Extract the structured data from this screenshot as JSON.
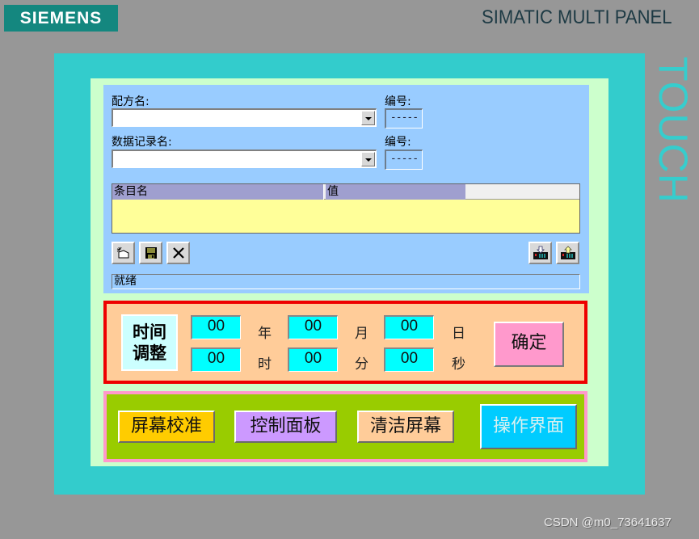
{
  "header": {
    "brand": "SIEMENS",
    "model": "SIMATIC MULTI PANEL",
    "touch_label": "TOUCH"
  },
  "recipe": {
    "recipe_name_label": "配方名:",
    "recipe_name_value": "",
    "recipe_number_label": "编号:",
    "recipe_number_value": "-----",
    "record_name_label": "数据记录名:",
    "record_name_value": "",
    "record_number_label": "编号:",
    "record_number_value": "-----",
    "table": {
      "columns": [
        "条目名",
        "值"
      ],
      "rows": []
    },
    "toolbar": {
      "new_icon": "new-record-icon",
      "save_icon": "save-icon",
      "delete_icon": "delete-icon",
      "to_plc_icon": "download-to-plc-icon",
      "from_plc_icon": "upload-from-plc-icon"
    },
    "status": "就绪"
  },
  "time_adjust": {
    "title_line1": "时间",
    "title_line2": "调整",
    "fields": [
      {
        "value": "00",
        "unit": "年"
      },
      {
        "value": "00",
        "unit": "月"
      },
      {
        "value": "00",
        "unit": "日"
      },
      {
        "value": "00",
        "unit": "时"
      },
      {
        "value": "00",
        "unit": "分"
      },
      {
        "value": "00",
        "unit": "秒"
      }
    ],
    "confirm_label": "确定",
    "colors": {
      "border": "#ee0000",
      "background": "#ffcc99",
      "field": "#00ffff",
      "confirm": "#ff99cc"
    }
  },
  "nav": {
    "buttons": [
      {
        "label": "屏幕校准",
        "color": "#ffcc00",
        "text_color": "#111111"
      },
      {
        "label": "控制面板",
        "color": "#cc99ff",
        "text_color": "#111111"
      },
      {
        "label": "清洁屏幕",
        "color": "#ffcc99",
        "text_color": "#111111"
      },
      {
        "label": "操作界面",
        "color": "#00ccff",
        "text_color": "#d8f0f0"
      }
    ]
  },
  "watermark": "CSDN @m0_73641637"
}
